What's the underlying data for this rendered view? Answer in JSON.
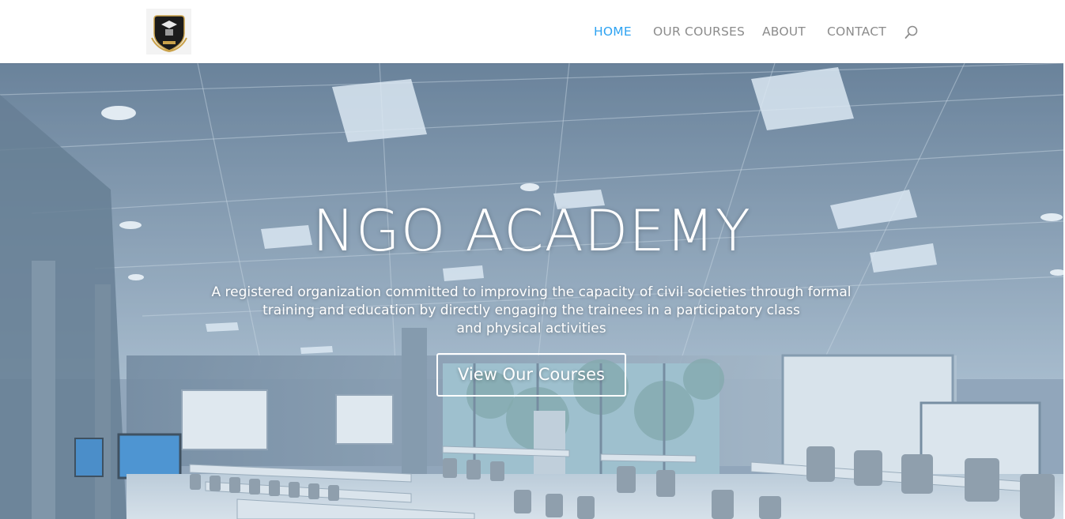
{
  "header": {
    "logo_icon": "ngo-shield-logo-icon",
    "nav": [
      {
        "label": "HOME",
        "active": true
      },
      {
        "label": "OUR COURSES",
        "active": false
      },
      {
        "label": "ABOUT",
        "active": false
      },
      {
        "label": "CONTACT",
        "active": false
      }
    ],
    "search_icon": "search-icon",
    "active_color": "#2ea3f2",
    "inactive_color": "#8c8c8c"
  },
  "hero": {
    "title": "NGO ACADEMY",
    "description_lines": [
      "A registered organization committed to improving the capacity of civil societies through formal",
      "training and education by directly engaging the trainees in a participatory class",
      "and physical activities"
    ],
    "button_label": "View Our Courses",
    "background": "classroom-photo"
  }
}
